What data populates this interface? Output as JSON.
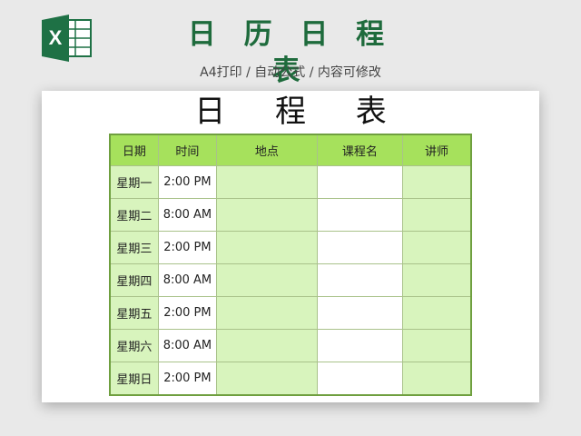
{
  "banner": {
    "title": "日 历 日 程 表",
    "subtitle": "A4打印 / 自动公式 / 内容可修改",
    "logo_icon": "excel-icon",
    "logo_letter": "X",
    "logo_color": "#1e7145"
  },
  "sheet": {
    "title": "日 程 表",
    "table": {
      "headers": [
        "日期",
        "时间",
        "地点",
        "课程名",
        "讲师"
      ],
      "rows": [
        {
          "day": "星期一",
          "time": "2:00 PM",
          "place": "",
          "course": "",
          "teacher": ""
        },
        {
          "day": "星期二",
          "time": "8:00 AM",
          "place": "",
          "course": "",
          "teacher": ""
        },
        {
          "day": "星期三",
          "time": "2:00 PM",
          "place": "",
          "course": "",
          "teacher": ""
        },
        {
          "day": "星期四",
          "time": "8:00 AM",
          "place": "",
          "course": "",
          "teacher": ""
        },
        {
          "day": "星期五",
          "time": "2:00 PM",
          "place": "",
          "course": "",
          "teacher": ""
        },
        {
          "day": "星期六",
          "time": "8:00 AM",
          "place": "",
          "course": "",
          "teacher": ""
        },
        {
          "day": "星期日",
          "time": "2:00 PM",
          "place": "",
          "course": "",
          "teacher": ""
        }
      ]
    }
  },
  "colors": {
    "header_bg": "#a6e15c",
    "light_green": "#d8f4bd",
    "title_green": "#1e6b3c",
    "table_border": "#6f9f3f"
  }
}
